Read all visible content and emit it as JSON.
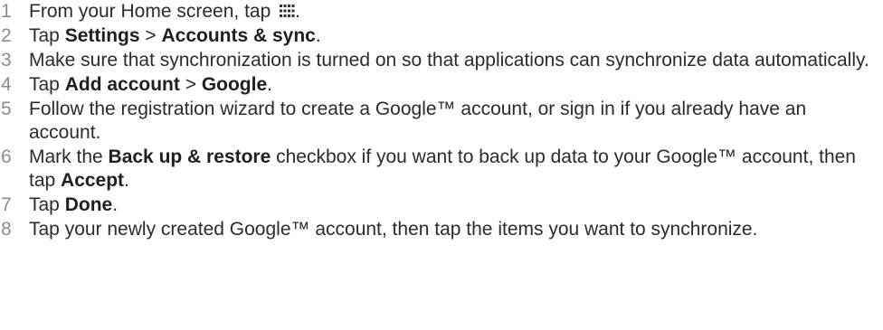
{
  "steps": [
    {
      "number": "1",
      "parts": {
        "t1": "From your Home screen, tap ",
        "icon": "apps-grid-icon",
        "t2": "."
      }
    },
    {
      "number": "2",
      "parts": {
        "t1": "Tap ",
        "b1": "Settings",
        "t2": " > ",
        "b2": "Accounts & sync",
        "t3": "."
      }
    },
    {
      "number": "3",
      "parts": {
        "t1": "Make sure that synchronization is turned on so that applications can synchronize data automatically."
      }
    },
    {
      "number": "4",
      "parts": {
        "t1": "Tap ",
        "b1": "Add account",
        "t2": " > ",
        "b2": "Google",
        "t3": "."
      }
    },
    {
      "number": "5",
      "parts": {
        "t1": "Follow the registration wizard to create a Google™ account, or sign in if you already have an account."
      }
    },
    {
      "number": "6",
      "parts": {
        "t1": "Mark the ",
        "b1": "Back up & restore",
        "t2": " checkbox if you want to back up data to your Google™ account, then tap ",
        "b2": "Accept",
        "t3": "."
      }
    },
    {
      "number": "7",
      "parts": {
        "t1": "Tap ",
        "b1": "Done",
        "t2": "."
      }
    },
    {
      "number": "8",
      "parts": {
        "t1": "Tap your newly created Google™ account, then tap the items you want to synchronize."
      }
    }
  ]
}
